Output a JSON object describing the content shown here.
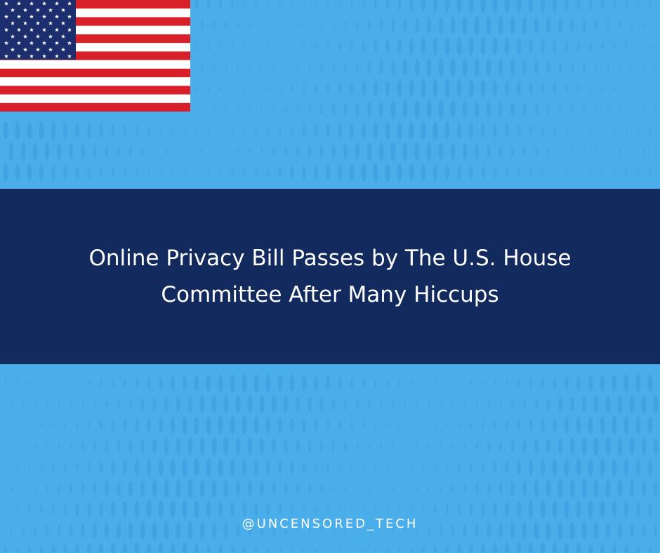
{
  "colors": {
    "background": "#4aaeea",
    "banner": "#132a5e",
    "text": "#ffffff",
    "flag_red": "#d8202a",
    "flag_blue": "#1d2e6e",
    "flag_white": "#ffffff"
  },
  "flag": {
    "icon": "us-flag-icon"
  },
  "headline": {
    "line1": "Online Privacy Bill Passes by The U.S. House",
    "line2": "Committee After Many Hiccups"
  },
  "footer": {
    "handle": "@UNCENSORED_TECH"
  }
}
